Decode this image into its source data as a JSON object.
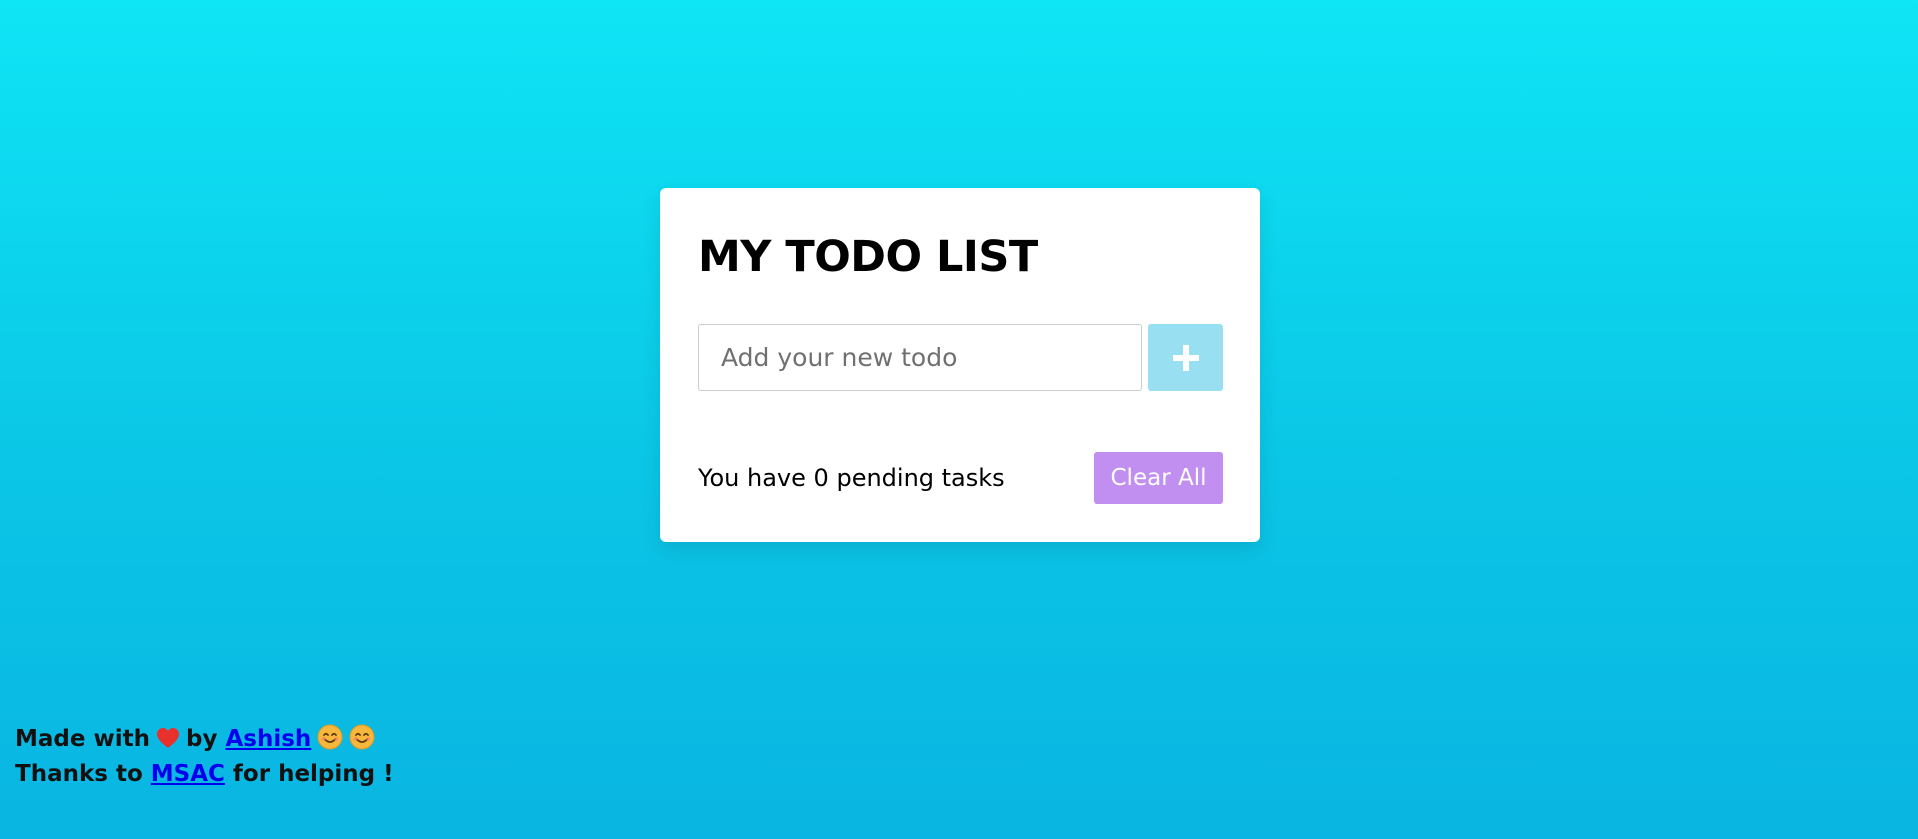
{
  "todo_card": {
    "title": "MY TODO LIST",
    "input": {
      "placeholder": "Add your new todo",
      "value": ""
    },
    "add_button": {
      "icon": "plus-icon"
    },
    "pending": {
      "prefix": "You have",
      "count": "0",
      "suffix": "pending tasks"
    },
    "clear_button": {
      "label": "Clear All"
    }
  },
  "credits": {
    "line1": {
      "made_with": "Made with",
      "heart_icon": "heart-icon",
      "by": "by",
      "author_link": "Ashish",
      "emoji_icons": [
        "smiling-face-icon",
        "smiling-face-icon"
      ]
    },
    "line2": {
      "thanks_to": "Thanks to",
      "helper_link": "MSAC",
      "for_helping": "for helping !"
    }
  },
  "colors": {
    "background_top": "#0ee5f5",
    "background_bottom": "#09b5e2",
    "add_button": "#98dff2",
    "clear_button": "#c08ff0",
    "link": "#0000ee",
    "heart": "#e8302c"
  }
}
